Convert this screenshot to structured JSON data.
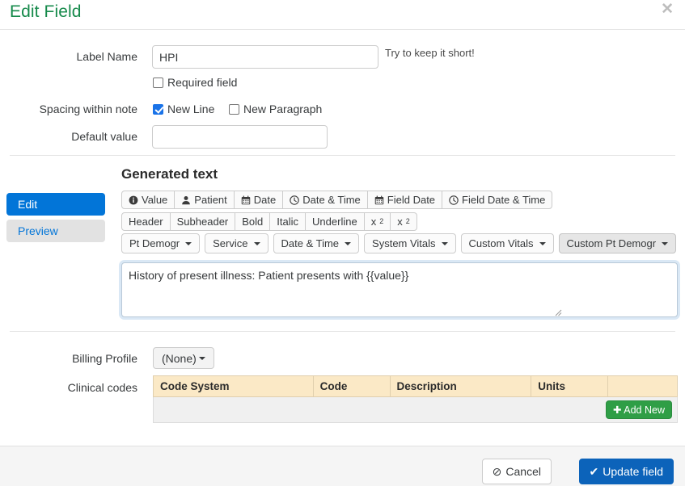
{
  "dialog": {
    "title": "Edit Field",
    "close_icon": "close-icon"
  },
  "form": {
    "label_name": {
      "label": "Label Name",
      "value": "HPI",
      "hint": "Try to keep it short!"
    },
    "required_field": {
      "label": "Required field",
      "checked": false
    },
    "spacing": {
      "label": "Spacing within note",
      "new_line": {
        "label": "New Line",
        "checked": true
      },
      "new_paragraph": {
        "label": "New Paragraph",
        "checked": false
      }
    },
    "default_value": {
      "label": "Default value",
      "value": "",
      "placeholder": ""
    }
  },
  "side_tabs": [
    {
      "label": "Edit",
      "active": true
    },
    {
      "label": "Preview",
      "active": false
    }
  ],
  "generated_text": {
    "heading": "Generated text",
    "insert_buttons": [
      {
        "label": "Value",
        "icon": "info-circle-icon"
      },
      {
        "label": "Patient",
        "icon": "user-icon"
      },
      {
        "label": "Date",
        "icon": "calendar-icon"
      },
      {
        "label": "Date & Time",
        "icon": "clock-icon"
      },
      {
        "label": "Field Date",
        "icon": "calendar-icon"
      },
      {
        "label": "Field Date & Time",
        "icon": "clock-icon"
      }
    ],
    "format_buttons": [
      {
        "label": "Header"
      },
      {
        "label": "Subheader"
      },
      {
        "label": "Bold"
      },
      {
        "label": "Italic"
      },
      {
        "label": "Underline"
      },
      {
        "label": "x",
        "sub": "2"
      },
      {
        "label": "x",
        "sup": "2"
      }
    ],
    "dropdowns": [
      {
        "label": "Pt Demogr",
        "active": false
      },
      {
        "label": "Service",
        "active": false
      },
      {
        "label": "Date & Time",
        "active": false
      },
      {
        "label": "System Vitals",
        "active": false
      },
      {
        "label": "Custom Vitals",
        "active": false
      },
      {
        "label": "Custom Pt Demogr",
        "active": true
      }
    ],
    "textarea_value": "History of present illness: Patient presents with {{value}}"
  },
  "billing": {
    "label": "Billing Profile",
    "selected": "(None)"
  },
  "clinical_codes": {
    "label": "Clinical codes",
    "columns": [
      "Code System",
      "Code",
      "Description",
      "Units",
      ""
    ],
    "rows": [],
    "add_new_label": "Add New",
    "add_new_icon": "plus-icon"
  },
  "footer": {
    "cancel_label": "Cancel",
    "cancel_icon": "ban-icon",
    "update_label": "Update field",
    "update_icon": "check-icon"
  },
  "colors": {
    "title_green": "#168a4b",
    "primary_blue": "#0275d8",
    "submit_blue": "#0c63ba",
    "add_green": "#2f9e46",
    "table_header_tan": "#fbe9c6"
  }
}
